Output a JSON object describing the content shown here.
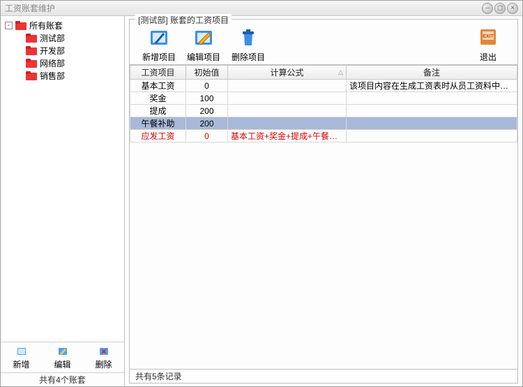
{
  "window": {
    "title": "工资账套维护"
  },
  "winbtns": {
    "min": "–",
    "max": "◻",
    "close": "×"
  },
  "tree": {
    "root": {
      "label": "所有账套",
      "expander": "-"
    },
    "items": [
      {
        "label": "测试部"
      },
      {
        "label": "开发部"
      },
      {
        "label": "网络部"
      },
      {
        "label": "销售部"
      }
    ]
  },
  "left_buttons": {
    "add": "新增",
    "edit": "编辑",
    "delete": "删除"
  },
  "left_status": "共有4个账套",
  "group_title": "[测试部] 账套的工资项目",
  "toolbar": {
    "add": "新增项目",
    "edit": "编辑项目",
    "delete": "删除项目",
    "exit": "退出"
  },
  "columns": {
    "item": "工资项目",
    "init": "初始值",
    "formula": "计算公式",
    "remark": "备注"
  },
  "rows": [
    {
      "item": "基本工资",
      "init": "0",
      "formula": "",
      "remark": "该项目内容在生成工资表时从员工资料中自动导入",
      "selected": false,
      "red": false
    },
    {
      "item": "奖金",
      "init": "100",
      "formula": "",
      "remark": "",
      "selected": false,
      "red": false
    },
    {
      "item": "提成",
      "init": "200",
      "formula": "",
      "remark": "",
      "selected": false,
      "red": false
    },
    {
      "item": "午餐补助",
      "init": "200",
      "formula": "",
      "remark": "",
      "selected": true,
      "red": false
    },
    {
      "item": "应发工资",
      "init": "0",
      "formula": "基本工资+奖金+提成+午餐补助",
      "remark": "",
      "selected": false,
      "red": true
    }
  ],
  "right_status": "共有5条记录",
  "icons": {
    "exit_text": "EXIT"
  }
}
